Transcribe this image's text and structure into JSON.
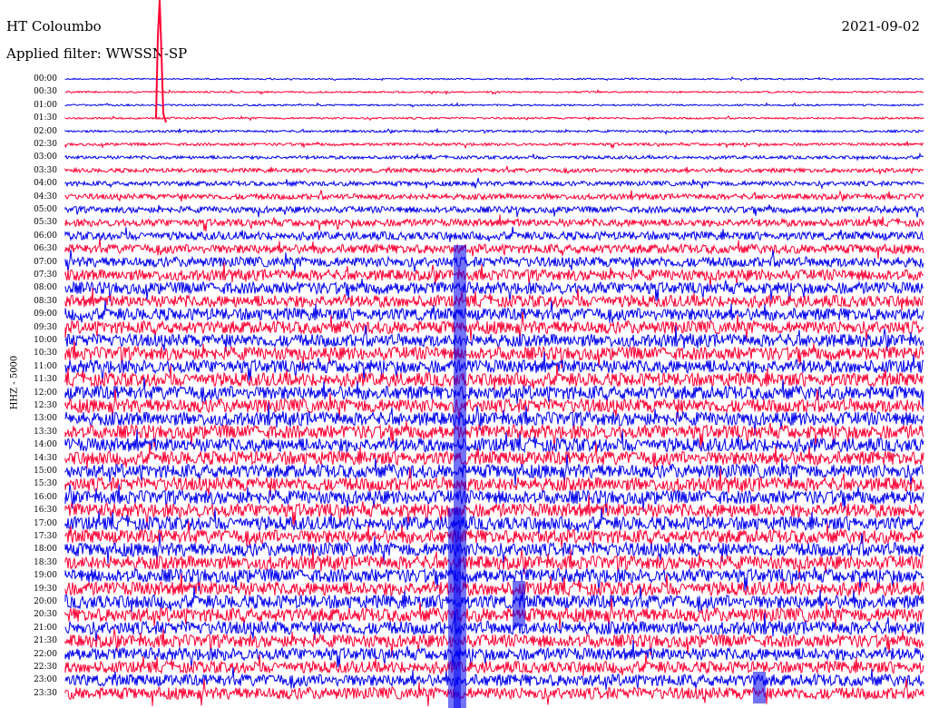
{
  "header": {
    "station": "HT Coloumbo",
    "date": "2021-09-02",
    "filter": "Applied filter: WWSSN-SP"
  },
  "chart_data": {
    "type": "line",
    "ylabel": "HHZ - 5000",
    "row_labels": [
      "00:00",
      "00:30",
      "01:00",
      "01:30",
      "02:00",
      "02:30",
      "03:00",
      "03:30",
      "04:00",
      "04:30",
      "05:00",
      "05:30",
      "06:00",
      "06:30",
      "07:00",
      "07:30",
      "08:00",
      "08:30",
      "09:00",
      "09:30",
      "10:00",
      "10:30",
      "11:00",
      "11:30",
      "12:00",
      "12:30",
      "13:00",
      "13:30",
      "14:00",
      "14:30",
      "15:00",
      "15:30",
      "16:00",
      "16:30",
      "17:00",
      "17:30",
      "18:00",
      "18:30",
      "19:00",
      "19:30",
      "20:00",
      "20:30",
      "21:00",
      "21:30",
      "22:00",
      "22:30",
      "23:00",
      "23:30"
    ],
    "trace_colors": [
      "#0000ee",
      "#ff0033"
    ],
    "series": [
      {
        "amplitude": 0.15
      },
      {
        "amplitude": 0.18
      },
      {
        "amplitude": 0.18
      },
      {
        "amplitude": 0.2
      },
      {
        "amplitude": 0.25
      },
      {
        "amplitude": 0.3
      },
      {
        "amplitude": 0.35
      },
      {
        "amplitude": 0.45
      },
      {
        "amplitude": 0.5
      },
      {
        "amplitude": 0.6
      },
      {
        "amplitude": 0.7
      },
      {
        "amplitude": 0.8
      },
      {
        "amplitude": 0.9
      },
      {
        "amplitude": 1.0
      },
      {
        "amplitude": 1.1
      },
      {
        "amplitude": 1.2
      },
      {
        "amplitude": 1.3
      },
      {
        "amplitude": 1.3
      },
      {
        "amplitude": 1.35
      },
      {
        "amplitude": 1.4
      },
      {
        "amplitude": 1.4
      },
      {
        "amplitude": 1.45
      },
      {
        "amplitude": 1.45
      },
      {
        "amplitude": 1.5
      },
      {
        "amplitude": 1.5
      },
      {
        "amplitude": 1.5
      },
      {
        "amplitude": 1.5
      },
      {
        "amplitude": 1.5
      },
      {
        "amplitude": 1.5
      },
      {
        "amplitude": 1.5
      },
      {
        "amplitude": 1.5
      },
      {
        "amplitude": 1.5
      },
      {
        "amplitude": 1.5
      },
      {
        "amplitude": 1.5
      },
      {
        "amplitude": 1.5
      },
      {
        "amplitude": 1.5
      },
      {
        "amplitude": 1.5
      },
      {
        "amplitude": 1.5
      },
      {
        "amplitude": 1.5
      },
      {
        "amplitude": 1.5
      },
      {
        "amplitude": 1.5
      },
      {
        "amplitude": 1.5
      },
      {
        "amplitude": 1.45
      },
      {
        "amplitude": 1.4
      },
      {
        "amplitude": 1.35
      },
      {
        "amplitude": 1.3
      },
      {
        "amplitude": 1.3
      },
      {
        "amplitude": 1.3
      }
    ]
  }
}
